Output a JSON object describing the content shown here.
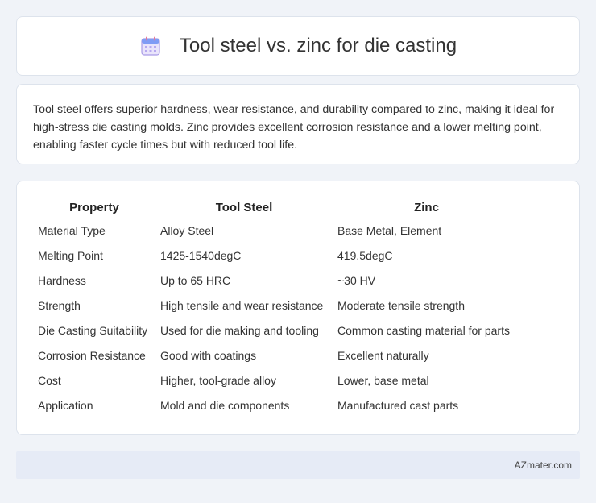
{
  "header": {
    "title": "Tool steel vs. zinc for die casting",
    "icon": "calendar-icon"
  },
  "description": "Tool steel offers superior hardness, wear resistance, and durability compared to zinc, making it ideal for high-stress die casting molds. Zinc provides excellent corrosion resistance and a lower melting point, enabling faster cycle times but with reduced tool life.",
  "table": {
    "headers": [
      "Property",
      "Tool Steel",
      "Zinc"
    ],
    "rows": [
      [
        "Material Type",
        "Alloy Steel",
        "Base Metal, Element"
      ],
      [
        "Melting Point",
        "1425-1540degC",
        "419.5degC"
      ],
      [
        "Hardness",
        "Up to 65 HRC",
        "~30 HV"
      ],
      [
        "Strength",
        "High tensile and wear resistance",
        "Moderate tensile strength"
      ],
      [
        "Die Casting Suitability",
        "Used for die making and tooling",
        "Common casting material for parts"
      ],
      [
        "Corrosion Resistance",
        "Good with coatings",
        "Excellent naturally"
      ],
      [
        "Cost",
        "Higher, tool-grade alloy",
        "Lower, base metal"
      ],
      [
        "Application",
        "Mold and die components",
        "Manufactured cast parts"
      ]
    ]
  },
  "footer": {
    "source": "AZmater.com"
  }
}
